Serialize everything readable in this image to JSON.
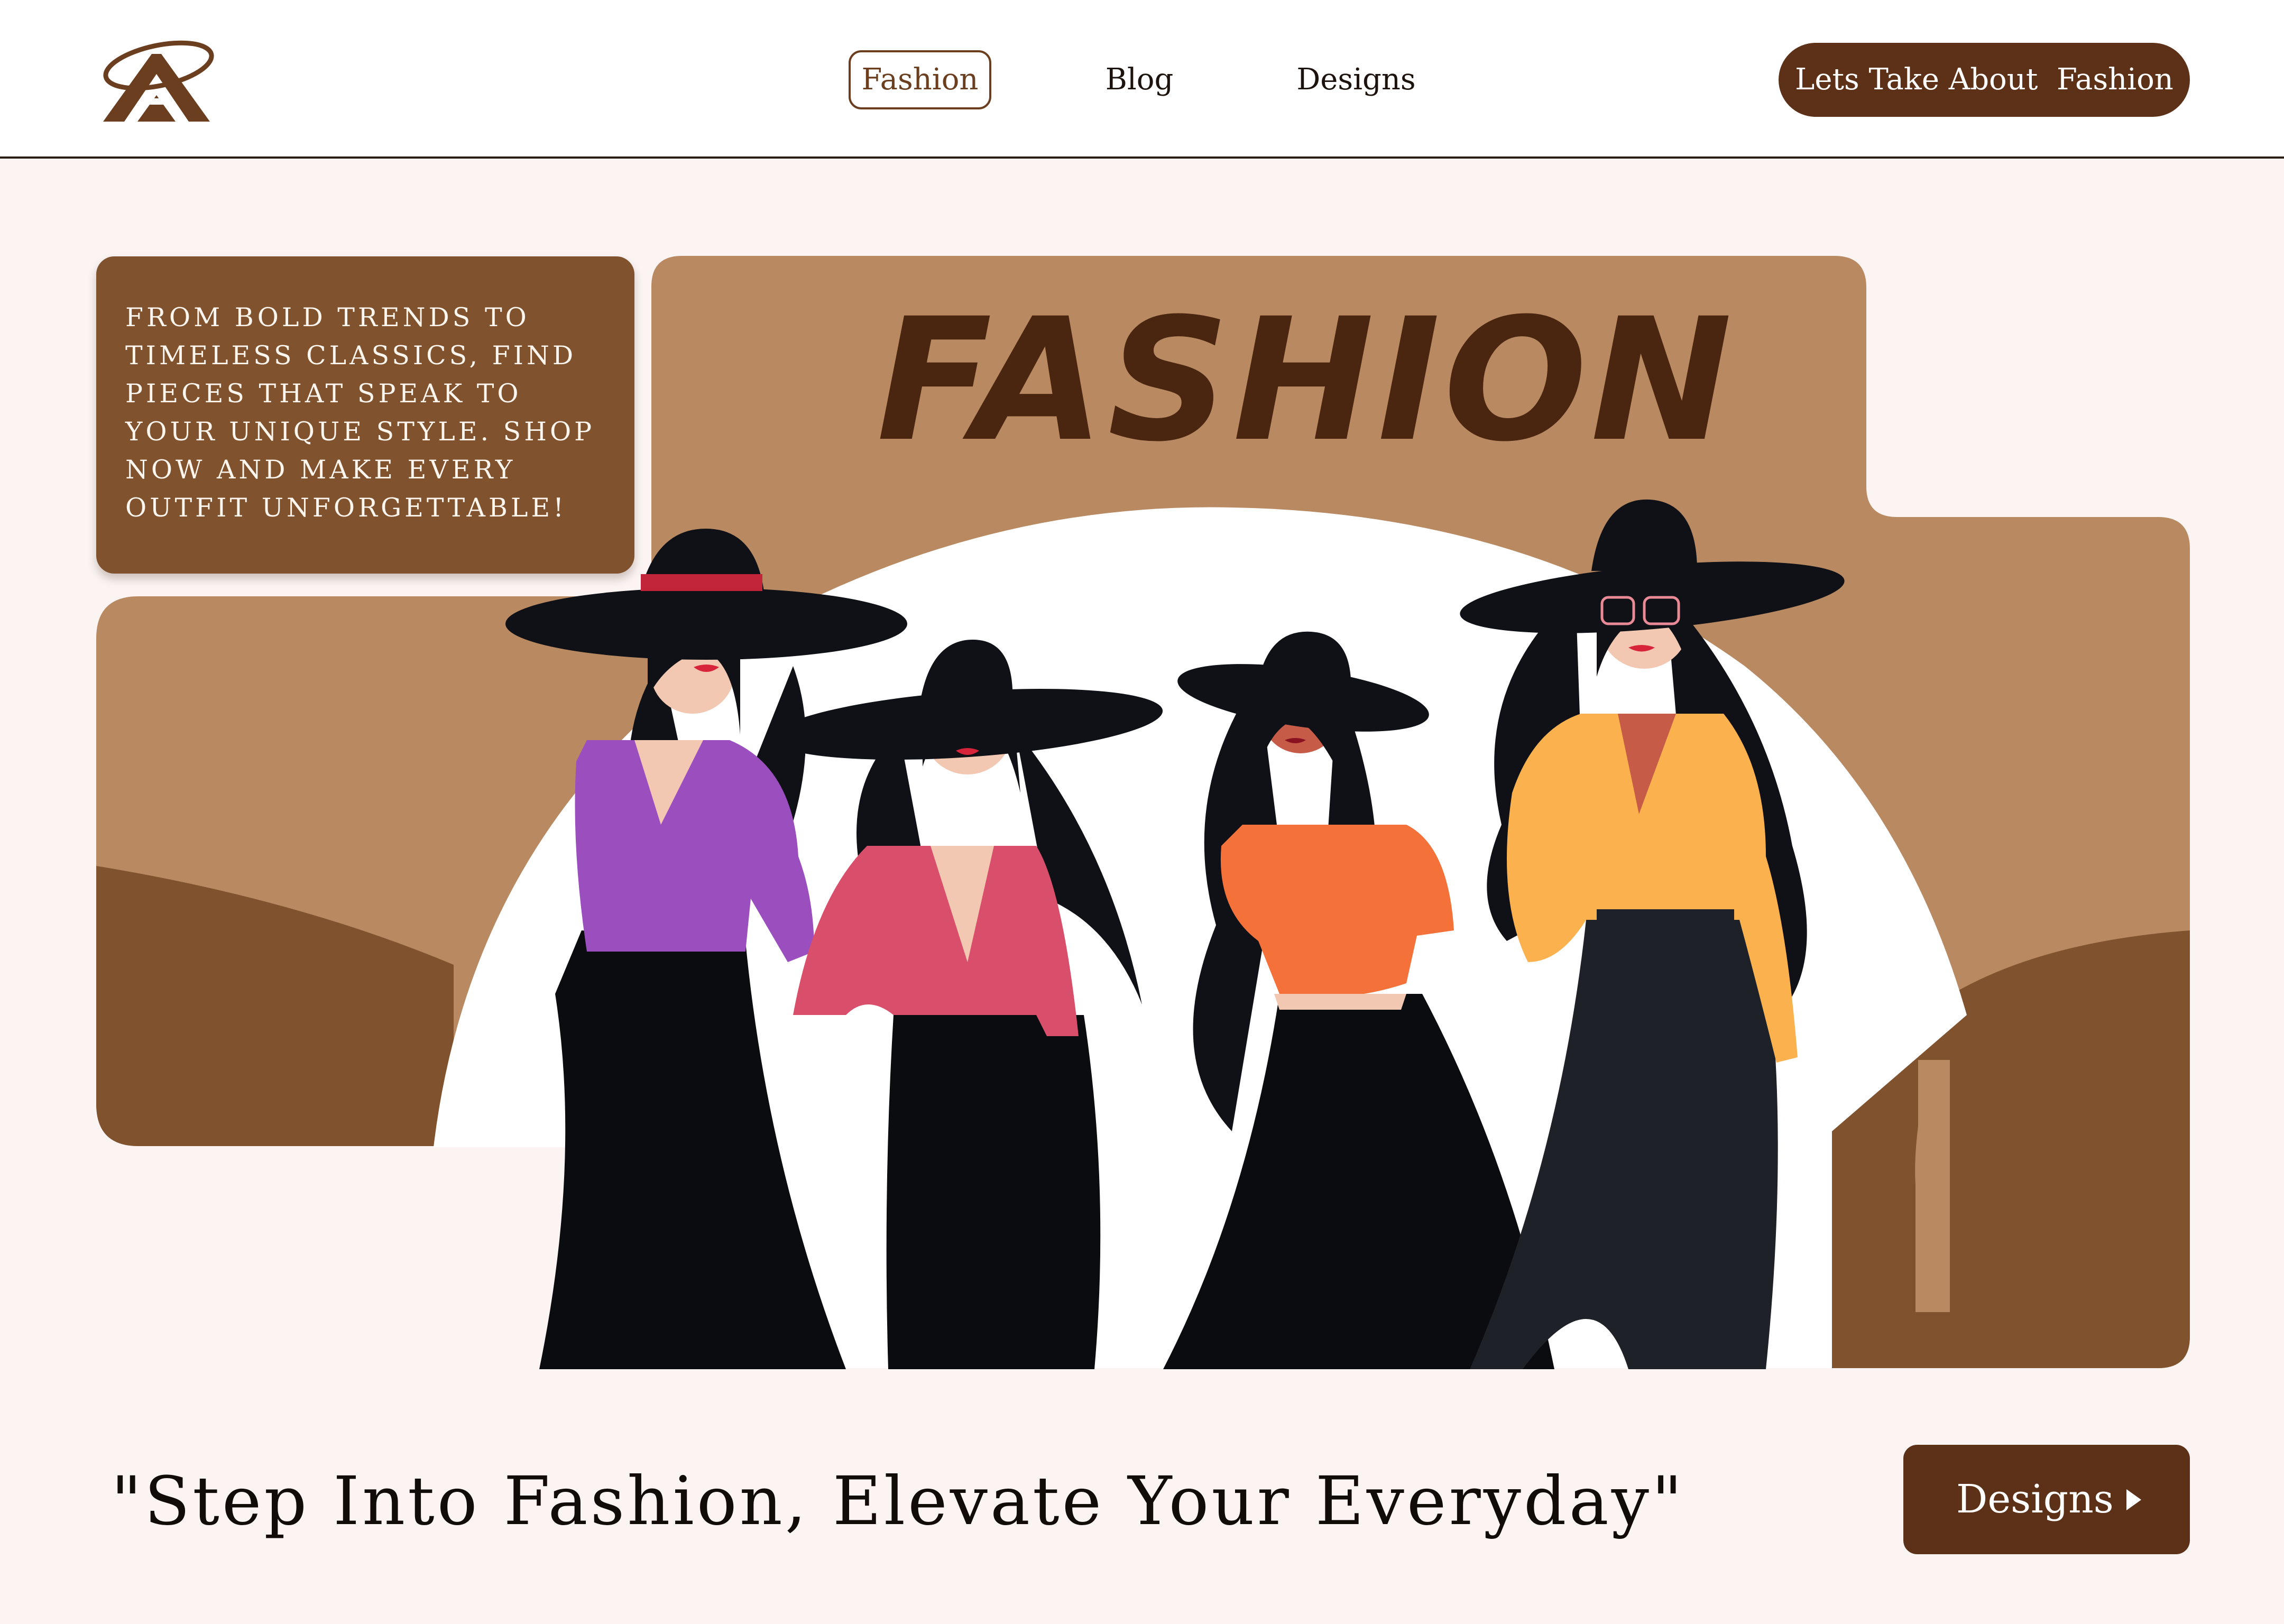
{
  "header": {
    "logo": {
      "icon": "a-monogram-logo-icon"
    },
    "nav": [
      {
        "label": "Fashion",
        "active": true
      },
      {
        "label": "Blog",
        "active": false
      },
      {
        "label": "Designs",
        "active": false
      }
    ],
    "cta_label": "Lets Take About  Fashion"
  },
  "hero": {
    "title": "FASHION",
    "promo_text": "FROM BOLD TRENDS TO TIMELESS CLASSICS, FIND PIECES THAT SPEAK TO YOUR UNIQUE STYLE. SHOP NOW AND MAKE EVERY OUTFIT UNFORGETTABLE!",
    "illustration": {
      "name": "four-women-in-hats-illustration",
      "figures": [
        "purple blouse",
        "pink blouse",
        "orange crop top",
        "yellow shirt"
      ]
    }
  },
  "footer": {
    "tagline": "\"Step Into Fashion, Elevate Your Everyday\"",
    "button_label": "Designs",
    "button_icon": "caret-right-icon"
  },
  "colors": {
    "brand_dark": "#5c3117",
    "panel_tan": "#b98a62",
    "panel_brown": "#80522e",
    "title_brown": "#4a2610",
    "page_bg": "#fbf4f3"
  }
}
